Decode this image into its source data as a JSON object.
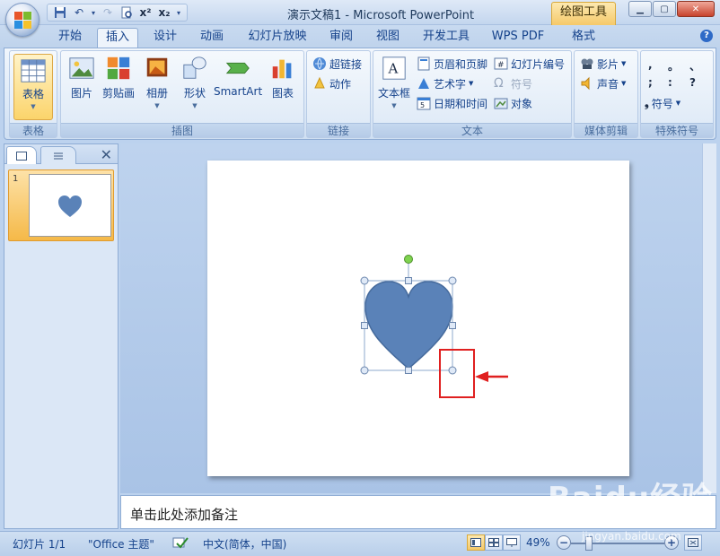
{
  "window": {
    "title": "演示文稿1 - Microsoft PowerPoint",
    "contextual_tab": "绘图工具",
    "controls": [
      "minimize",
      "maximize",
      "close"
    ]
  },
  "tabs": [
    {
      "label": "开始",
      "active": false
    },
    {
      "label": "插入",
      "active": true
    },
    {
      "label": "设计",
      "active": false
    },
    {
      "label": "动画",
      "active": false
    },
    {
      "label": "幻灯片放映",
      "active": false
    },
    {
      "label": "审阅",
      "active": false
    },
    {
      "label": "视图",
      "active": false
    },
    {
      "label": "开发工具",
      "active": false
    },
    {
      "label": "WPS PDF",
      "active": false
    },
    {
      "label": "格式",
      "active": false
    }
  ],
  "ribbon": {
    "groups": {
      "table": {
        "label": "表格",
        "buttons": [
          "表格"
        ]
      },
      "illustrations": {
        "label": "插图",
        "buttons": [
          "图片",
          "剪贴画",
          "相册",
          "形状",
          "SmartArt",
          "图表"
        ]
      },
      "links": {
        "label": "链接",
        "buttons": [
          "超链接",
          "动作"
        ]
      },
      "text": {
        "label": "文本",
        "big": "文本框",
        "buttons": [
          "页眉和页脚",
          "幻灯片编号",
          "艺术字",
          "符号",
          "日期和时间",
          "对象"
        ]
      },
      "media": {
        "label": "媒体剪辑",
        "buttons": [
          "影片",
          "声音"
        ]
      },
      "special": {
        "label": "特殊符号",
        "symbols": [
          ",",
          "。",
          "、",
          ";",
          ":",
          "?"
        ],
        "button": "符号"
      }
    }
  },
  "left_pane": {
    "slide_number": "1"
  },
  "notes": {
    "placeholder": "单击此处添加备注"
  },
  "status": {
    "slide_info": "幻灯片 1/1",
    "theme": "\"Office 主题\"",
    "language": "中文(简体，中国)",
    "zoom": "49%"
  },
  "watermark": {
    "text": "Baidu经验",
    "url": "jingyan.baidu.com"
  },
  "colors": {
    "heart_fill": "#5a82b8",
    "heart_stroke": "#456a9c",
    "annotation": "#e02020",
    "rotation_handle": "#7fd34f"
  }
}
